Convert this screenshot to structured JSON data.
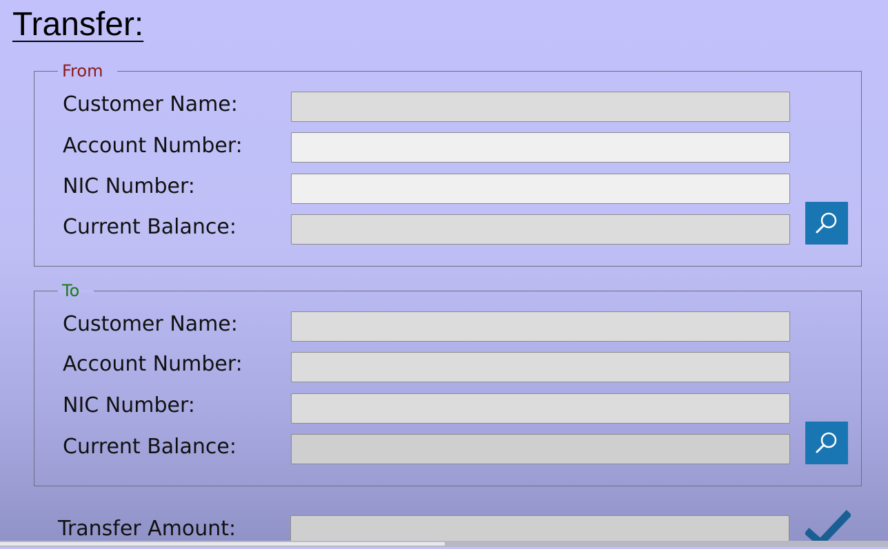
{
  "page": {
    "title": "Transfer:"
  },
  "from": {
    "legend": "From",
    "fields": [
      {
        "label": "Customer Name:",
        "value": "",
        "placeholder": ""
      },
      {
        "label": "Account Number:",
        "value": "",
        "placeholder": ""
      },
      {
        "label": "NIC Number:",
        "value": "",
        "placeholder": ""
      },
      {
        "label": "Current Balance:",
        "value": "",
        "placeholder": ""
      }
    ],
    "search_icon": "search-icon"
  },
  "to": {
    "legend": "To",
    "fields": [
      {
        "label": "Customer Name:",
        "value": "",
        "placeholder": ""
      },
      {
        "label": "Account Number:",
        "value": "",
        "placeholder": ""
      },
      {
        "label": "NIC Number:",
        "value": "",
        "placeholder": ""
      },
      {
        "label": "Current Balance:",
        "value": "",
        "placeholder": ""
      }
    ],
    "search_icon": "search-icon"
  },
  "transfer": {
    "amount_label": "Transfer Amount:",
    "amount_value": "",
    "confirm_icon": "checkmark-icon"
  },
  "colors": {
    "background": "#c2c1fb",
    "from_legend": "#8a1a1a",
    "to_legend": "#1a7a1a",
    "search_button": "#1a76b2",
    "checkmark": "#1a5f94"
  }
}
